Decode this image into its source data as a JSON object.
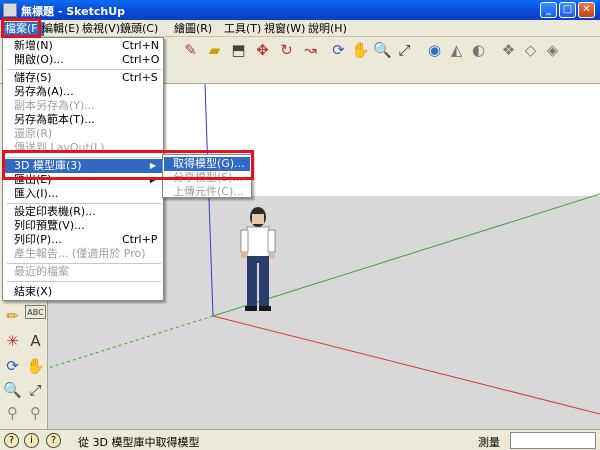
{
  "window": {
    "title": "無標題 - SketchUp",
    "app_icon": "sketchup-app-icon",
    "controls": [
      "minimize",
      "maximize",
      "close"
    ]
  },
  "menubar": {
    "items": [
      {
        "label": "檔案(F)",
        "active": true
      },
      {
        "label": "編輯(E)"
      },
      {
        "label": "檢視(V)"
      },
      {
        "label": "鏡頭(C)"
      },
      {
        "label": "繪圖(R)"
      },
      {
        "label": "工具(T)"
      },
      {
        "label": "視窗(W)"
      },
      {
        "label": "說明(H)"
      }
    ]
  },
  "file_menu": {
    "items": [
      {
        "label": "新增(N)",
        "shortcut": "Ctrl+N"
      },
      {
        "label": "開啟(O)...",
        "shortcut": "Ctrl+O"
      },
      {
        "label": "儲存(S)",
        "shortcut": "Ctrl+S"
      },
      {
        "label": "另存為(A)...",
        "shortcut": ""
      },
      {
        "label": "副本另存為(Y)...",
        "shortcut": "",
        "disabled": true
      },
      {
        "label": "另存為範本(T)...",
        "shortcut": ""
      },
      {
        "label": "還原(R)",
        "shortcut": "",
        "disabled": true
      },
      {
        "label": "傳送到 LayOut(L)",
        "shortcut": "",
        "disabled": true
      },
      {
        "label": "3D 模型庫(3)",
        "shortcut": "",
        "submenu": true,
        "highlighted": true
      },
      {
        "label": "匯出(E)",
        "shortcut": ""
      },
      {
        "label": "匯入(I)...",
        "shortcut": ""
      },
      {
        "label": "設定印表機(R)...",
        "shortcut": ""
      },
      {
        "label": "列印預覽(V)...",
        "shortcut": ""
      },
      {
        "label": "列印(P)...",
        "shortcut": "Ctrl+P"
      },
      {
        "label": "產生報告... (僅適用於 Pro)",
        "shortcut": "",
        "disabled": true
      },
      {
        "label": "最近的檔案",
        "shortcut": "",
        "disabled": true
      },
      {
        "label": "結束(X)",
        "shortcut": ""
      }
    ]
  },
  "gallery_submenu": {
    "items": [
      {
        "label": "取得模型(G)...",
        "highlighted": true
      },
      {
        "label": "分享模型(S)...",
        "disabled": true
      },
      {
        "label": "上傳元件(C)...",
        "disabled": true
      }
    ]
  },
  "statusbar": {
    "text": "從 3D 模型庫中取得模型",
    "measure_label": "測量",
    "measure_value": "",
    "icons": [
      "geo-location-icon",
      "credits-icon",
      "help-icon"
    ]
  },
  "colors": {
    "titlebar": "#0a52dd",
    "highlight": "#316ac5",
    "annotation_red": "#e8101a",
    "axis_red": "#d43a3a",
    "axis_green": "#3ca83c",
    "axis_blue": "#3a3ad0",
    "ground": "#d8d8d8"
  },
  "annotations": {
    "boxes": [
      "file-menu-title",
      "3d-gallery-and-get-models"
    ]
  }
}
